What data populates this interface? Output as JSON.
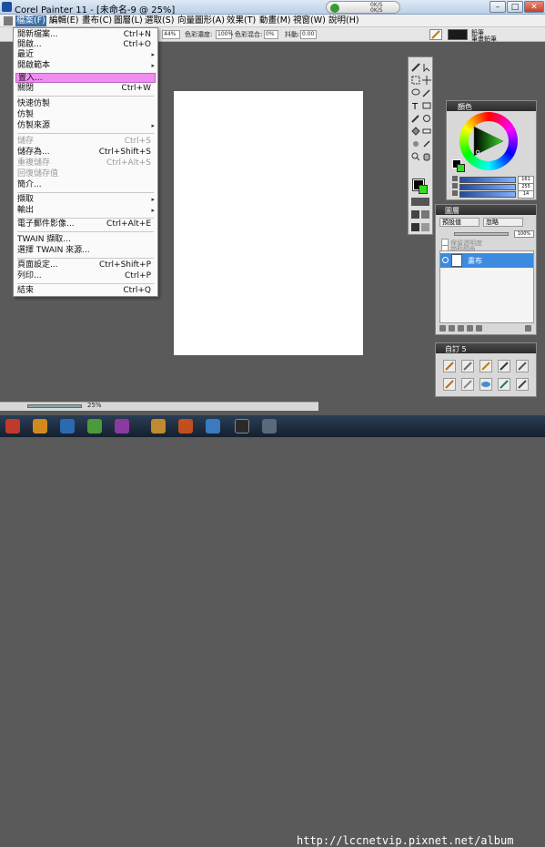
{
  "window": {
    "title": "Corel Painter 11 - [未命名-9 @ 25%]",
    "tray_line1": "0K/S",
    "tray_line2": "0K/S",
    "minimize": "–",
    "maximize": "□",
    "close": "✕"
  },
  "menubar": [
    {
      "label": "檔案(F)",
      "active": true
    },
    {
      "label": "編輯(E)"
    },
    {
      "label": "畫布(C)"
    },
    {
      "label": "圖層(L)"
    },
    {
      "label": "選取(S)"
    },
    {
      "label": "向量圖形(A)"
    },
    {
      "label": "效果(T)"
    },
    {
      "label": "動畫(M)"
    },
    {
      "label": "視窗(W)"
    },
    {
      "label": "說明(H)"
    }
  ],
  "propbar": {
    "size_value": "44%",
    "color_concentration_label": "色彩濃度:",
    "color_concentration_value": "100%",
    "color_blend_label": "色彩混合:",
    "color_blend_value": "0%",
    "jitter_label": "抖動:",
    "jitter_value": "0.00",
    "brush_name_line1": "鉛筆",
    "brush_name_line2": "筆畫鉛筆"
  },
  "file_menu": {
    "items": [
      {
        "label": "開新檔案...",
        "shortcut": "Ctrl+N"
      },
      {
        "label": "開啟...",
        "shortcut": "Ctrl+O"
      },
      {
        "label": "最近",
        "submenu": true
      },
      {
        "label": "開啟範本",
        "submenu": true
      },
      {
        "label": "置入...",
        "highlight": true
      },
      {
        "label": "關閉",
        "shortcut": "Ctrl+W"
      },
      {
        "separator": true
      },
      {
        "label": "快速仿製"
      },
      {
        "label": "仿製"
      },
      {
        "label": "仿製來源",
        "submenu": true
      },
      {
        "separator": true
      },
      {
        "label": "儲存",
        "shortcut": "Ctrl+S",
        "disabled": true
      },
      {
        "label": "儲存為...",
        "shortcut": "Ctrl+Shift+S"
      },
      {
        "label": "重複儲存",
        "shortcut": "Ctrl+Alt+S",
        "disabled": true
      },
      {
        "label": "回復儲存值",
        "disabled": true
      },
      {
        "label": "簡介..."
      },
      {
        "separator": true
      },
      {
        "label": "擷取",
        "submenu": true
      },
      {
        "label": "輸出",
        "submenu": true
      },
      {
        "separator": true
      },
      {
        "label": "電子郵件影像...",
        "shortcut": "Ctrl+Alt+E"
      },
      {
        "separator": true
      },
      {
        "label": "TWAIN 擷取..."
      },
      {
        "label": "選擇 TWAIN 來源..."
      },
      {
        "separator": true
      },
      {
        "label": "頁面設定...",
        "shortcut": "Ctrl+Shift+P"
      },
      {
        "label": "列印...",
        "shortcut": "Ctrl+P"
      },
      {
        "separator": true
      },
      {
        "label": "結束",
        "shortcut": "Ctrl+Q"
      }
    ]
  },
  "color_panel": {
    "title": "顏色",
    "rgb_values": [
      "161",
      "255",
      "14"
    ],
    "main_color": "#000000",
    "additional_color": "#33dd22"
  },
  "layers_panel": {
    "title": "圖層",
    "composite_method": "預設值",
    "composite_depth": "忽略",
    "opacity_value": "100%",
    "option_preserve": "保留透明度",
    "option_pick_up": "擷取顏色",
    "layer_name": "畫布"
  },
  "custom_palette": {
    "title": "自訂 5"
  },
  "status": {
    "zoom_value": "25%"
  },
  "watermark": "http://lccnetvip.pixnet.net/album"
}
